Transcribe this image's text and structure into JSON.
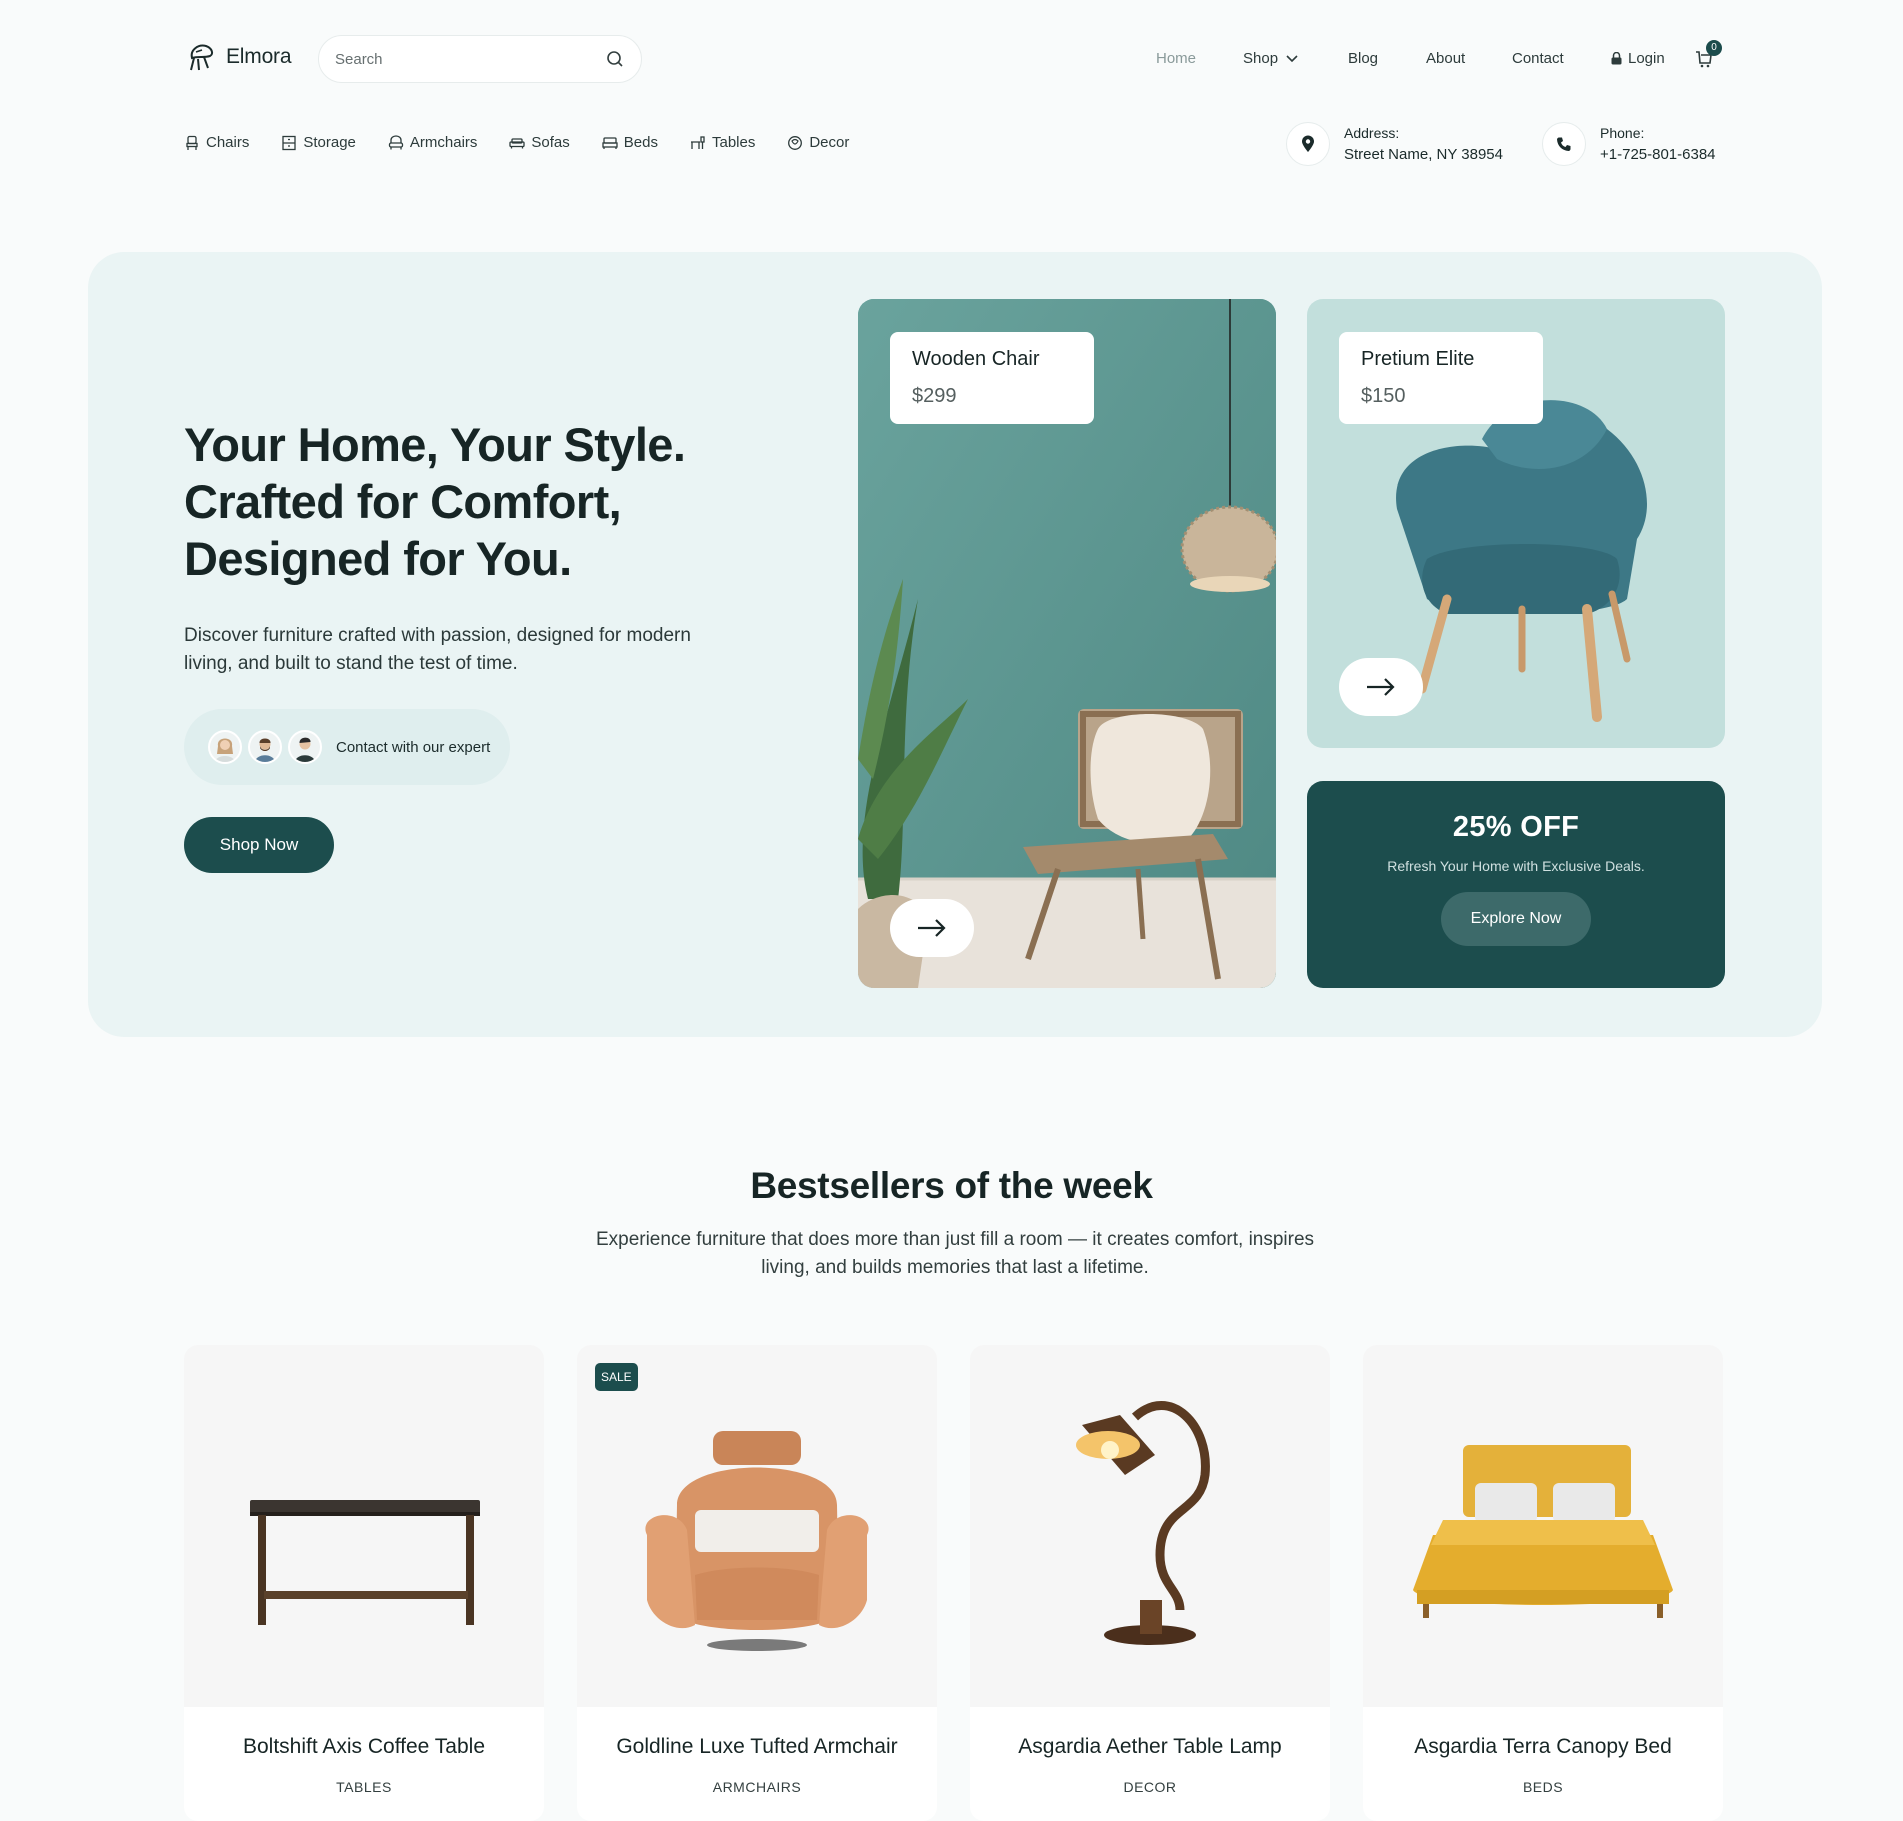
{
  "brand": {
    "name": "Elmora"
  },
  "search": {
    "placeholder": "Search"
  },
  "nav": {
    "home": "Home",
    "shop": "Shop",
    "blog": "Blog",
    "about": "About",
    "contact": "Contact",
    "login": "Login",
    "cart_count": "0"
  },
  "categories": [
    {
      "label": "Chairs",
      "icon": "chair-icon"
    },
    {
      "label": "Storage",
      "icon": "storage-icon"
    },
    {
      "label": "Armchairs",
      "icon": "armchair-icon"
    },
    {
      "label": "Sofas",
      "icon": "sofa-icon"
    },
    {
      "label": "Beds",
      "icon": "bed-icon"
    },
    {
      "label": "Tables",
      "icon": "table-icon"
    },
    {
      "label": "Decor",
      "icon": "decor-icon"
    }
  ],
  "contact": {
    "address_label": "Address:",
    "address_value": "Street Name, NY 38954",
    "phone_label": "Phone:",
    "phone_value": "+1-725-801-6384"
  },
  "hero": {
    "title_line1": "Your Home, Your Style.",
    "title_line2": "Crafted for Comfort,",
    "title_line3": "Designed for You.",
    "description": "Discover furniture crafted with passion, designed for modern living, and built to stand the test of time.",
    "expert_text": "Contact with our expert",
    "shop_button": "Shop Now",
    "card1": {
      "name": "Wooden Chair",
      "price": "$299"
    },
    "card2": {
      "name": "Pretium Elite",
      "price": "$150"
    },
    "offer": {
      "title": "25% OFF",
      "subtitle": "Refresh Your Home with Exclusive Deals.",
      "button": "Explore Now"
    }
  },
  "bestsellers": {
    "title": "Bestsellers of the week",
    "subtitle": "Experience furniture that does more than just fill a room — it creates comfort, inspires living, and builds memories that last a lifetime.",
    "products": [
      {
        "name": "Boltshift Axis Coffee Table",
        "category": "TABLES"
      },
      {
        "name": "Goldline Luxe Tufted Armchair",
        "category": "ARMCHAIRS",
        "badge": "SALE"
      },
      {
        "name": "Asgardia Aether Table Lamp",
        "category": "DECOR"
      },
      {
        "name": "Asgardia Terra Canopy Bed",
        "category": "BEDS"
      }
    ]
  },
  "colors": {
    "accent": "#1c4d4d",
    "hero_bg": "#eaf4f4",
    "page_bg": "#f9fbfb"
  }
}
